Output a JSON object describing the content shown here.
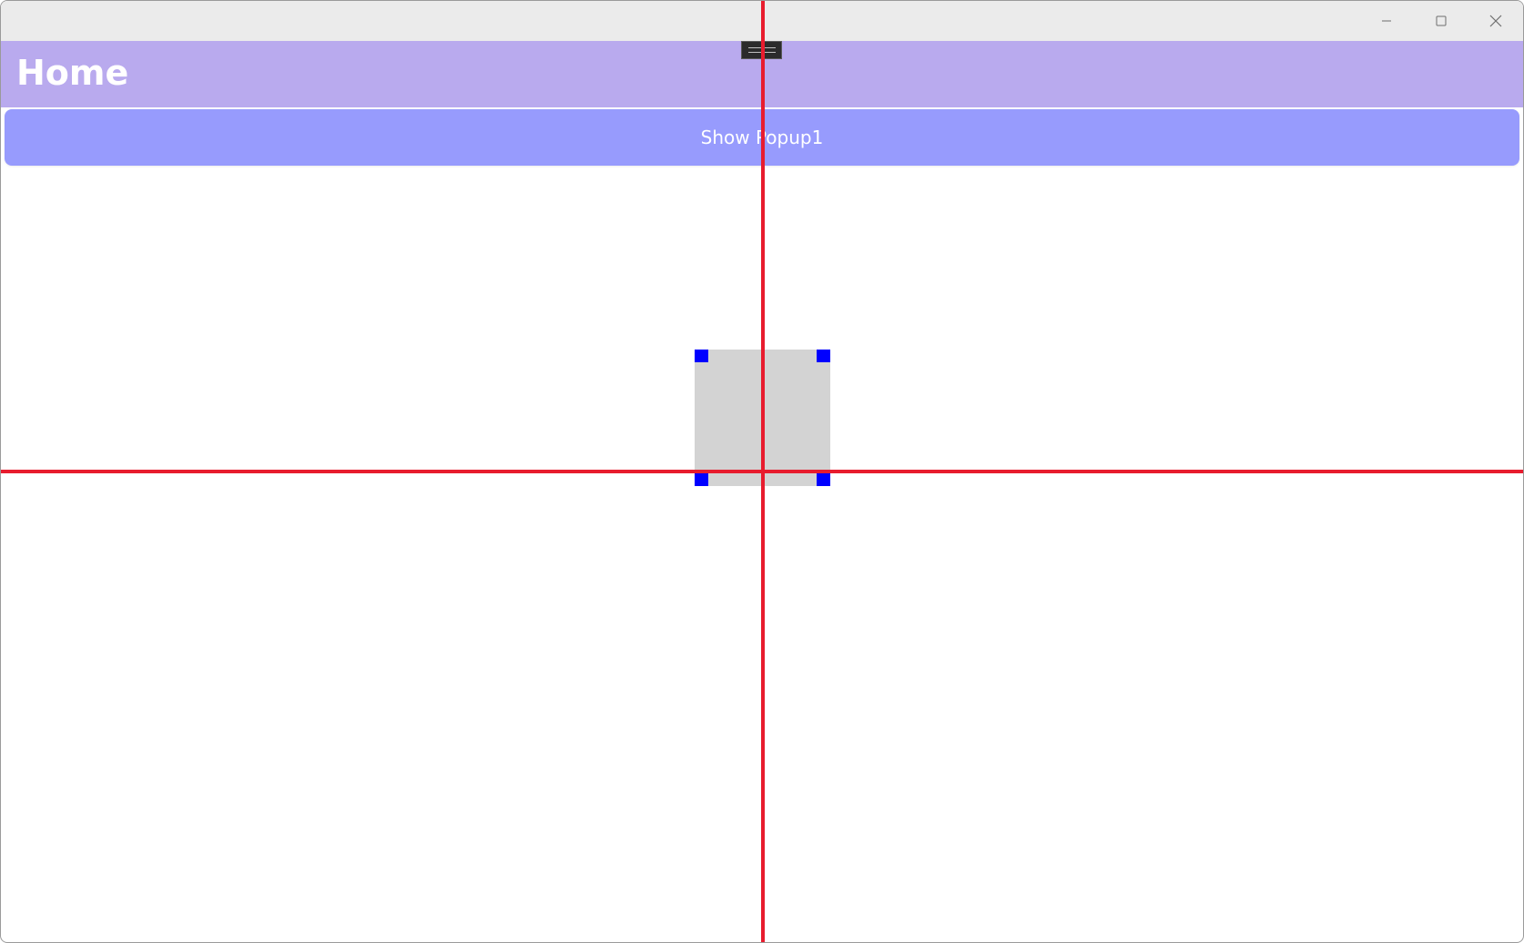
{
  "window": {
    "caption_buttons": {
      "minimize_icon": "minimize-icon",
      "maximize_icon": "maximize-icon",
      "close_icon": "close-icon"
    }
  },
  "header": {
    "title": "Home",
    "background": "#b9aaee"
  },
  "main": {
    "popup_button_label": "Show Popup1",
    "popup_button_color": "#979bfd"
  },
  "overlay": {
    "guide_color": "#e81c2e",
    "handle_color": "#0000ff",
    "selection_fill": "#d3d3d3",
    "toolbar_icon": "drag-handle-icon"
  }
}
